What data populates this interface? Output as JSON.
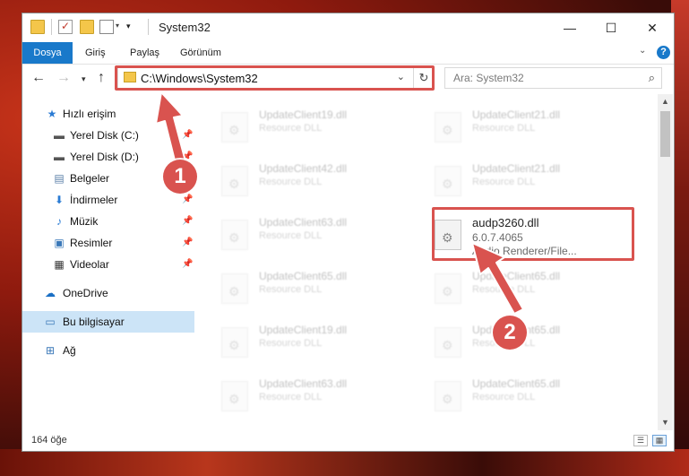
{
  "window": {
    "title": "System32",
    "controls": {
      "minimize": "—",
      "maximize": "☐",
      "close": "✕"
    }
  },
  "ribbon": {
    "tabs": [
      "Dosya",
      "Giriş",
      "Paylaş",
      "Görünüm"
    ],
    "help": "?"
  },
  "address": {
    "path": "C:\\Windows\\System32",
    "search_placeholder": "Ara: System32"
  },
  "sidebar": {
    "items": [
      {
        "label": "Hızlı erişim",
        "icon": "star-icon"
      },
      {
        "label": "Yerel Disk (C:)",
        "icon": "drive-icon"
      },
      {
        "label": "Yerel Disk (D:)",
        "icon": "drive-icon"
      },
      {
        "label": "Belgeler",
        "icon": "document-icon"
      },
      {
        "label": "İndirmeler",
        "icon": "download-icon"
      },
      {
        "label": "Müzik",
        "icon": "music-icon"
      },
      {
        "label": "Resimler",
        "icon": "picture-icon"
      },
      {
        "label": "Videolar",
        "icon": "video-icon"
      },
      {
        "label": "OneDrive",
        "icon": "cloud-icon"
      },
      {
        "label": "Bu bilgisayar",
        "icon": "computer-icon"
      },
      {
        "label": "Ağ",
        "icon": "network-icon"
      }
    ]
  },
  "files": {
    "left": [
      {
        "name": "UpdateClient19.dll",
        "desc": "Resource DLL"
      },
      {
        "name": "UpdateClient42.dll",
        "desc": "Resource DLL"
      },
      {
        "name": "UpdateClient63.dll",
        "desc": "Resource DLL"
      },
      {
        "name": "UpdateClient65.dll",
        "desc": "Resource DLL"
      },
      {
        "name": "UpdateClient19.dll",
        "desc": "Resource DLL"
      },
      {
        "name": "UpdateClient63.dll",
        "desc": "Resource DLL"
      }
    ],
    "right": [
      {
        "name": "UpdateClient21.dll",
        "desc": "Resource DLL"
      },
      {
        "name": "UpdateClient21.dll",
        "desc": "Resource DLL"
      },
      {
        "name": "UpdateClient65.dll",
        "desc": "Resource DLL"
      },
      {
        "name": "UpdateClient65.dll",
        "desc": "Resource DLL"
      },
      {
        "name": "UpdateClient65.dll",
        "desc": "Resource DLL"
      }
    ],
    "highlighted": {
      "name": "audp3260.dll",
      "version": "6.0.7.4065",
      "desc": "Audio Renderer/File..."
    }
  },
  "status": {
    "item_count": "164 öğe"
  },
  "annotations": {
    "badge1": "1",
    "badge2": "2",
    "color": "#d9534f"
  }
}
